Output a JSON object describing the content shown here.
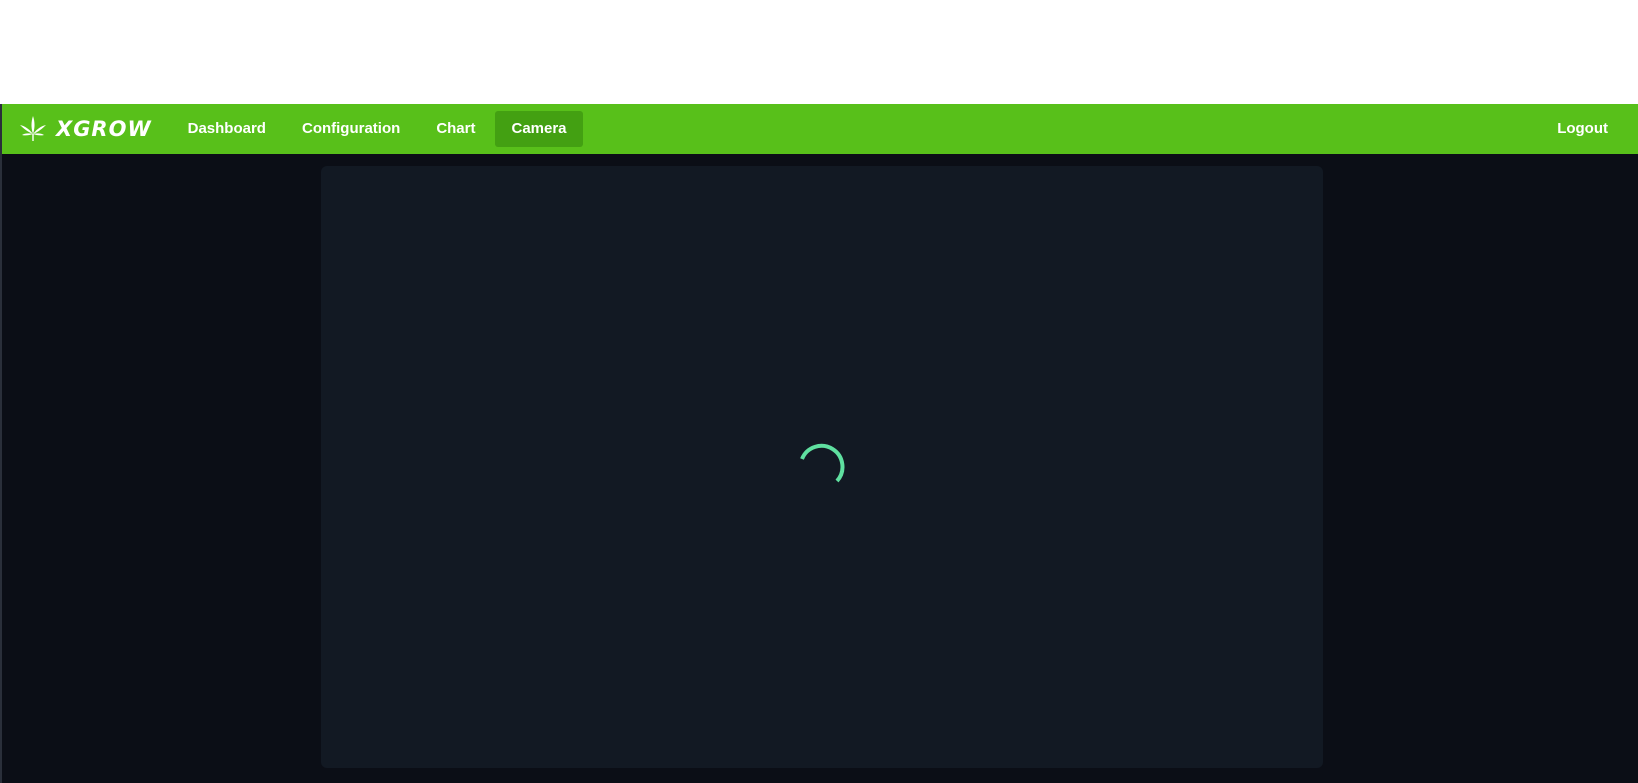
{
  "brand": {
    "name": "XGROW",
    "logo_icon": "cannabis-leaf-icon"
  },
  "nav": {
    "items": [
      {
        "label": "Dashboard",
        "active": false
      },
      {
        "label": "Configuration",
        "active": false
      },
      {
        "label": "Chart",
        "active": false
      },
      {
        "label": "Camera",
        "active": true
      }
    ],
    "logout_label": "Logout"
  },
  "camera": {
    "state_icon": "loading-spinner-icon"
  },
  "colors": {
    "navbar": "#58c01a",
    "navbar_active": "#43a012",
    "background": "#0b0e16",
    "panel": "#121923",
    "spinner": "#5fe0a0"
  }
}
